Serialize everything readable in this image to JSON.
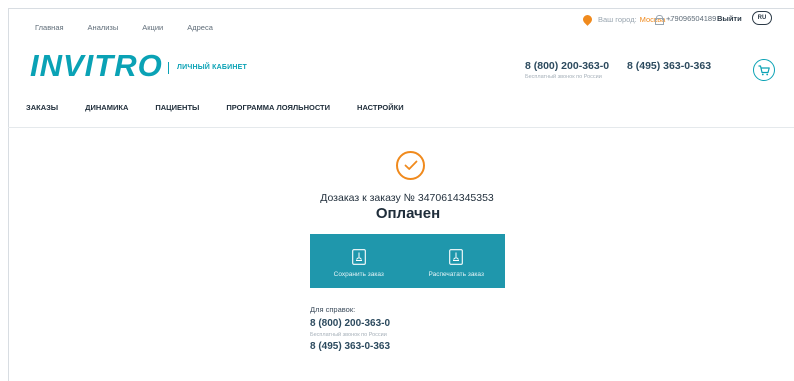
{
  "top_links": [
    "Главная",
    "Анализы",
    "Акции",
    "Адреса"
  ],
  "city": {
    "label": "Ваш город:",
    "value": "Москва"
  },
  "user": {
    "phone": "+79096504189",
    "logout_label": "Выйти"
  },
  "language": "RU",
  "header": {
    "logo": "INVITRO",
    "cabinet_label": "ЛИЧНЫЙ КАБИНЕТ",
    "phone_free": "8 (800) 200-363-0",
    "phone_free_note": "Бесплатный звонок по России",
    "phone_moscow": "8 (495) 363-0-363"
  },
  "nav": [
    "ЗАКАЗЫ",
    "ДИНАМИКА",
    "ПАЦИЕНТЫ",
    "ПРОГРАММА ЛОЯЛЬНОСТИ",
    "НАСТРОЙКИ"
  ],
  "order": {
    "title": "Дозаказ к заказу № 3470614345353",
    "status": "Оплачен"
  },
  "actions": {
    "save_label": "Сохранить заказ",
    "print_label": "Распечатать заказ"
  },
  "help": {
    "title": "Для справок:",
    "phone_free": "8 (800) 200-363-0",
    "phone_free_note": "Бесплатный звонок по России",
    "phone_moscow": "8 (495) 363-0-363"
  },
  "colors": {
    "brand": "#0aa2b5",
    "accent": "#f08a1d",
    "action_panel": "#1f97ac"
  }
}
